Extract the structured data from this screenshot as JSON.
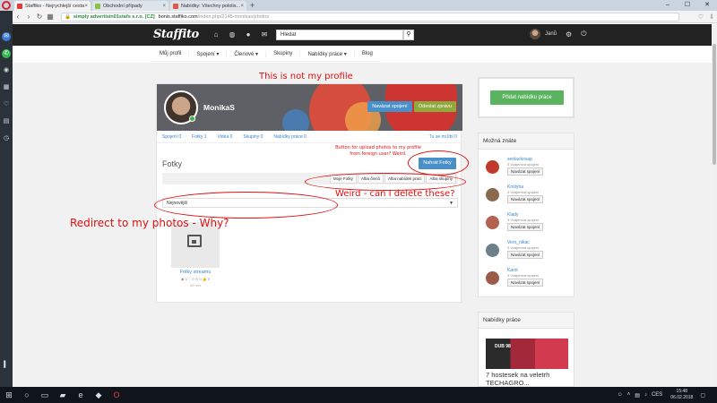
{
  "browser": {
    "tabs": [
      {
        "title": "Staffiko - Nejrychlejší cesta",
        "active": true,
        "fav_color": "#e03a3a"
      },
      {
        "title": "Obchodní případy",
        "active": false,
        "fav_color": "#8bc34a"
      },
      {
        "title": "Nabídky: Všechny pololis...",
        "active": false,
        "fav_color": "#e2554a"
      }
    ],
    "new_tab": "+",
    "url_secure": "simply advertisin01stafs s.r.o. [CZ]",
    "url_host": "bonis.staffiko.com",
    "url_path": "/index.php/2145-monikas/photos"
  },
  "site": {
    "logo": "Staffito",
    "search_placeholder": "Hledat",
    "user_name": "Janů",
    "subnav": [
      "Můj profil",
      "Spojení ▾",
      "Členové ▾",
      "Skupiny",
      "Nabídky práce ▾",
      "Blog"
    ]
  },
  "profile": {
    "name": "MonikaS",
    "connect_label": "Navázat spojení",
    "message_label": "Odeslat zprávu",
    "stats": [
      "Spojení 0",
      "Fotky 1",
      "Videa 0",
      "Skupiny 0",
      "Nabídky práce 0"
    ],
    "like_label": "Tu se mi líbí 0",
    "section_title": "Fotky",
    "upload_label": "Nahrát Fotky",
    "album_tabs": [
      "Moje Fotky",
      "Alba členů",
      "Alba nabídek prací",
      "Alba skupiny"
    ],
    "sort_value": "Nejnovější",
    "album": {
      "name": "Fotky streamu",
      "meta": "◉ 0  ♡ 0  ◷ 0  👍 0",
      "time": "32 min"
    }
  },
  "right": {
    "offer_button": "Přidat nabídku práce",
    "know_title": "Možná znáte",
    "people": [
      {
        "name": "seelackovap",
        "mutual": "3 Vzájemná spojení",
        "action": "Navázat spojení",
        "color": "#c0392b"
      },
      {
        "name": "Kristýna",
        "mutual": "3 Vzájemná spojení",
        "action": "Navázat spojení",
        "color": "#8a6a4e"
      },
      {
        "name": "Klady",
        "mutual": "3 Vzájemná spojení",
        "action": "Navázat spojení",
        "color": "#b2624e"
      },
      {
        "name": "Vero_nikac",
        "mutual": "3 Vzájemná spojení",
        "action": "Navázat spojení",
        "color": "#6d7f8a"
      },
      {
        "name": "Karol",
        "mutual": "3 Vzájemná spojení",
        "action": "Navázat spojení",
        "color": "#9b5a4a"
      }
    ],
    "jobs_title": "Nabídky práce",
    "job_badge": "DUB 98",
    "job_title": "7 hostesek na veletrh TECHAGRO..."
  },
  "annotations": {
    "not_profile": "This is not my profile",
    "upload_note": "Button for upload photos to my profile from foreign user? Weird.",
    "delete_note": "Weird - can I delete these?",
    "redirect_note": "Redirect to my photos - Why?"
  },
  "taskbar": {
    "tray_lang": "CES",
    "time": "15:48",
    "date": "06.02.2018"
  },
  "colors": {
    "brand_dark": "#222222",
    "link_blue": "#3a86c8",
    "button_blue": "#4a90c8",
    "button_green": "#5ab35f",
    "annotation_red": "#e01010"
  }
}
